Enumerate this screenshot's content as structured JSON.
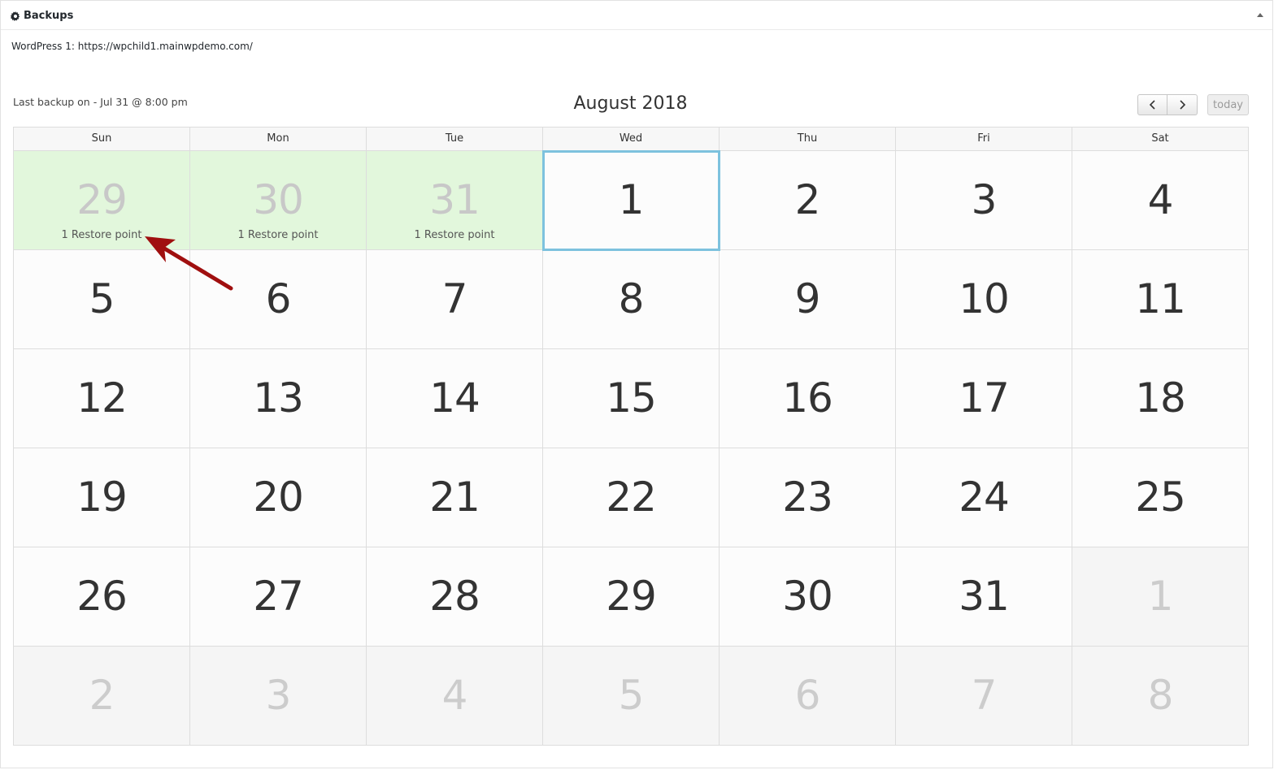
{
  "panel": {
    "title": "Backups",
    "icon": "gear-icon",
    "collapse_icon": "triangle-up-icon"
  },
  "site": {
    "label": "WordPress 1: https://wpchild1.mainwpdemo.com/"
  },
  "last_backup": "Last backup on - Jul 31 @ 8:00 pm",
  "calendar": {
    "month_title": "August 2018",
    "prev_icon": "chevron-left-icon",
    "next_icon": "chevron-right-icon",
    "today_label": "today",
    "days_of_week": [
      "Sun",
      "Mon",
      "Tue",
      "Wed",
      "Thu",
      "Fri",
      "Sat"
    ],
    "weeks": [
      [
        {
          "day": "29",
          "other_month": true,
          "restore": "1 Restore point"
        },
        {
          "day": "30",
          "other_month": true,
          "restore": "1 Restore point"
        },
        {
          "day": "31",
          "other_month": true,
          "restore": "1 Restore point"
        },
        {
          "day": "1",
          "today": true
        },
        {
          "day": "2"
        },
        {
          "day": "3"
        },
        {
          "day": "4"
        }
      ],
      [
        {
          "day": "5"
        },
        {
          "day": "6"
        },
        {
          "day": "7"
        },
        {
          "day": "8"
        },
        {
          "day": "9"
        },
        {
          "day": "10"
        },
        {
          "day": "11"
        }
      ],
      [
        {
          "day": "12"
        },
        {
          "day": "13"
        },
        {
          "day": "14"
        },
        {
          "day": "15"
        },
        {
          "day": "16"
        },
        {
          "day": "17"
        },
        {
          "day": "18"
        }
      ],
      [
        {
          "day": "19"
        },
        {
          "day": "20"
        },
        {
          "day": "21"
        },
        {
          "day": "22"
        },
        {
          "day": "23"
        },
        {
          "day": "24"
        },
        {
          "day": "25"
        }
      ],
      [
        {
          "day": "26"
        },
        {
          "day": "27"
        },
        {
          "day": "28"
        },
        {
          "day": "29"
        },
        {
          "day": "30"
        },
        {
          "day": "31"
        },
        {
          "day": "1",
          "other_month": true
        }
      ],
      [
        {
          "day": "2",
          "other_month": true
        },
        {
          "day": "3",
          "other_month": true
        },
        {
          "day": "4",
          "other_month": true
        },
        {
          "day": "5",
          "other_month": true
        },
        {
          "day": "6",
          "other_month": true
        },
        {
          "day": "7",
          "other_month": true
        },
        {
          "day": "8",
          "other_month": true
        }
      ]
    ]
  },
  "annotation": {
    "arrow_color": "#a00f0f",
    "icon": "pointer-arrow-icon"
  },
  "colors": {
    "backup_day_bg": "#e2f7dc",
    "today_outline": "#7dc2de"
  }
}
